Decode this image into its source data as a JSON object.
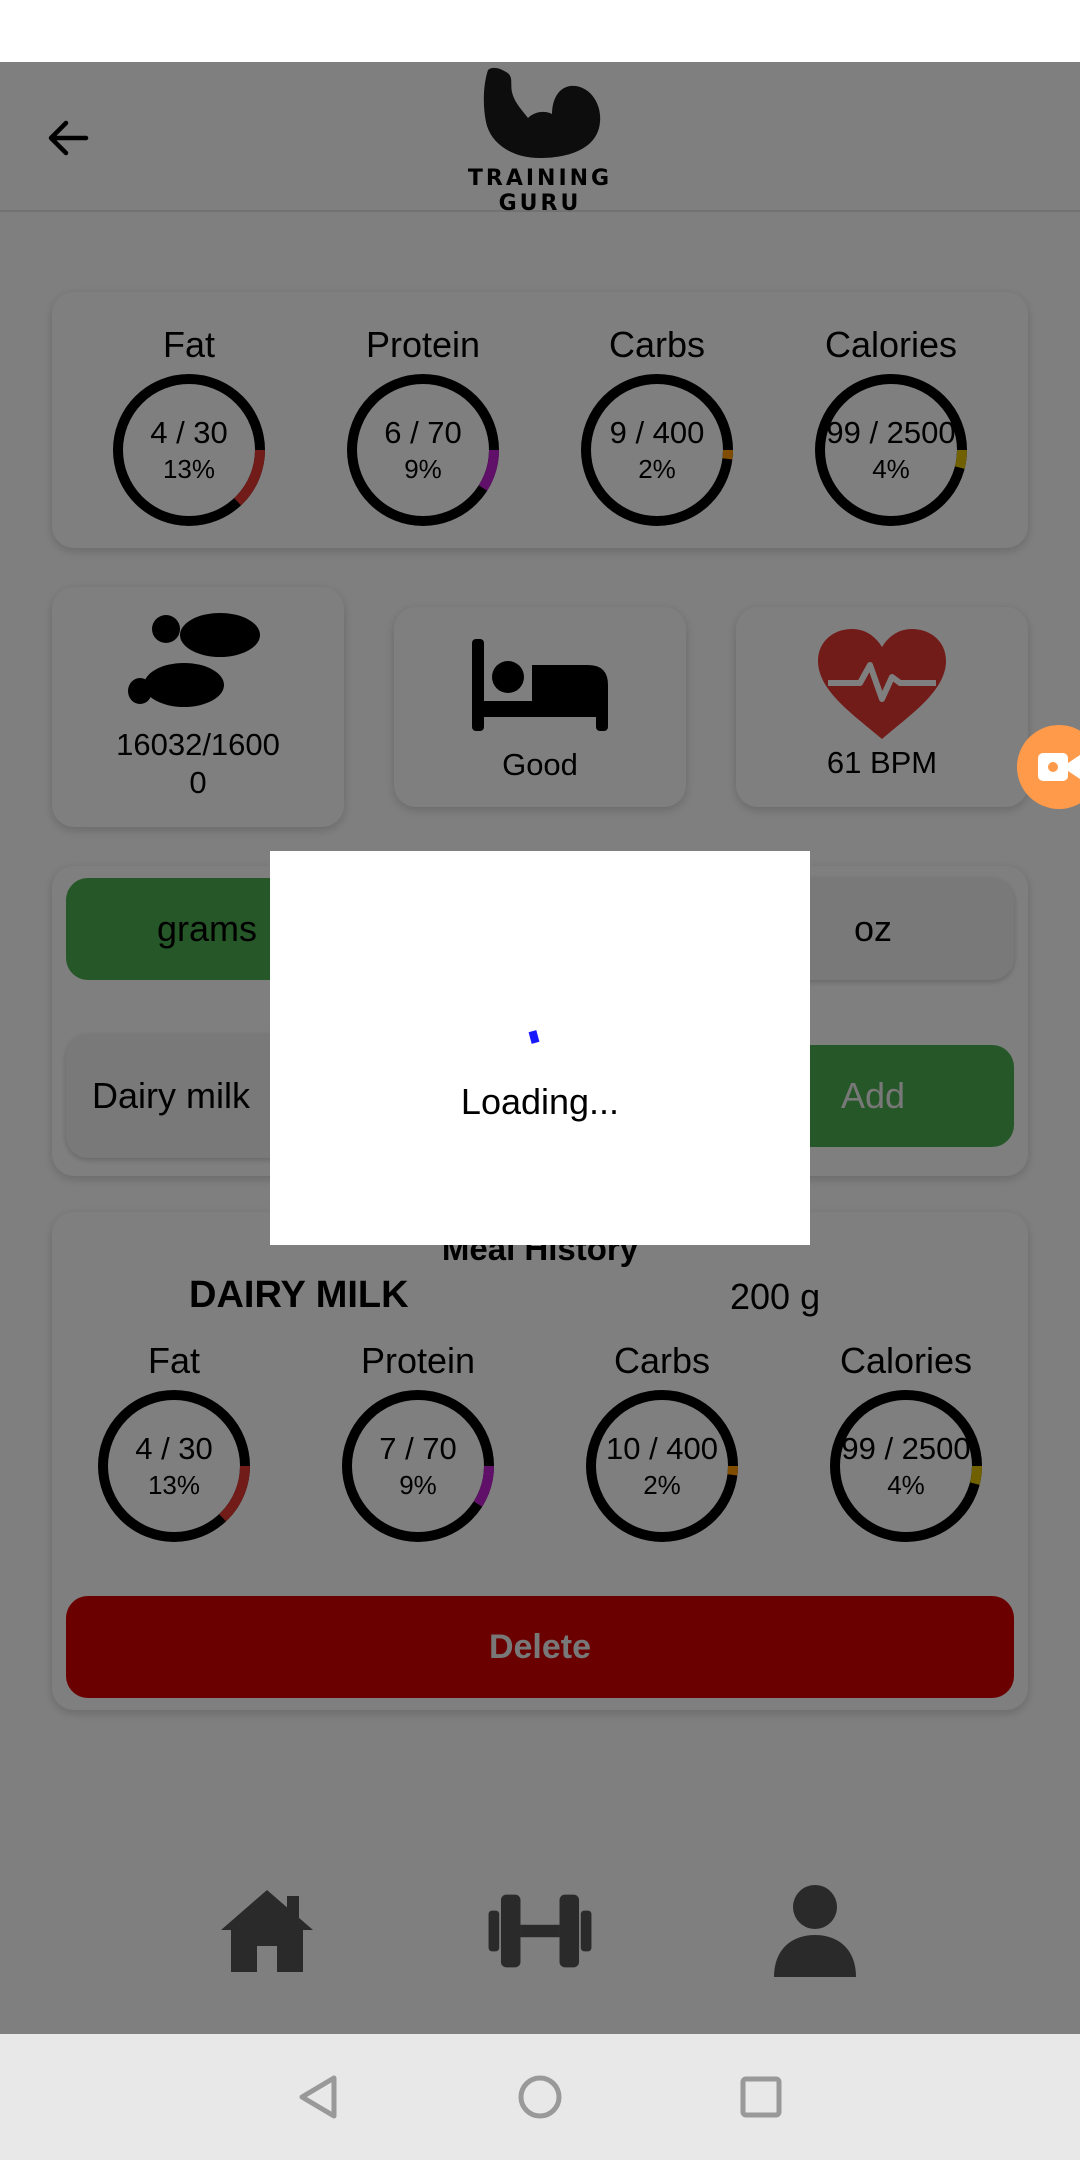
{
  "app": {
    "logo_text": "TRAINING GURU"
  },
  "summary": {
    "macros": [
      {
        "label": "Fat",
        "value": "4 / 30",
        "percent": "13%",
        "fraction": 0.13,
        "color": "#e53935"
      },
      {
        "label": "Protein",
        "value": "6 / 70",
        "percent": "9%",
        "fraction": 0.09,
        "color": "#c020d0"
      },
      {
        "label": "Carbs",
        "value": "9 / 400",
        "percent": "2%",
        "fraction": 0.02,
        "color": "#ff9800"
      },
      {
        "label": "Calories",
        "value": "99 / 2500",
        "percent": "4%",
        "fraction": 0.04,
        "color": "#e0c000"
      }
    ]
  },
  "stats": {
    "steps": "16032/16000",
    "sleep": "Good",
    "heart_rate": "61 BPM"
  },
  "add_food": {
    "unit_grams": "grams",
    "unit_oz": "oz",
    "food_value": "Dairy milk",
    "add_label": "Add"
  },
  "dialog": {
    "loading_text": "Loading..."
  },
  "meal_history": {
    "title": "Meal History",
    "item_name": "DAIRY MILK",
    "item_amount": "200 g",
    "macros": [
      {
        "label": "Fat",
        "value": "4 / 30",
        "percent": "13%",
        "fraction": 0.13,
        "color": "#e53935"
      },
      {
        "label": "Protein",
        "value": "7 / 70",
        "percent": "9%",
        "fraction": 0.09,
        "color": "#c020d0"
      },
      {
        "label": "Carbs",
        "value": "10 / 400",
        "percent": "2%",
        "fraction": 0.02,
        "color": "#ff9800"
      },
      {
        "label": "Calories",
        "value": "99 / 2500",
        "percent": "4%",
        "fraction": 0.04,
        "color": "#e0c000"
      }
    ],
    "delete_label": "Delete"
  },
  "bottom_nav": {
    "items": [
      "home-icon",
      "dumbbell-icon",
      "person-icon"
    ]
  },
  "system_nav": {
    "items": [
      "back-triangle-icon",
      "home-circle-icon",
      "recents-square-icon"
    ]
  }
}
